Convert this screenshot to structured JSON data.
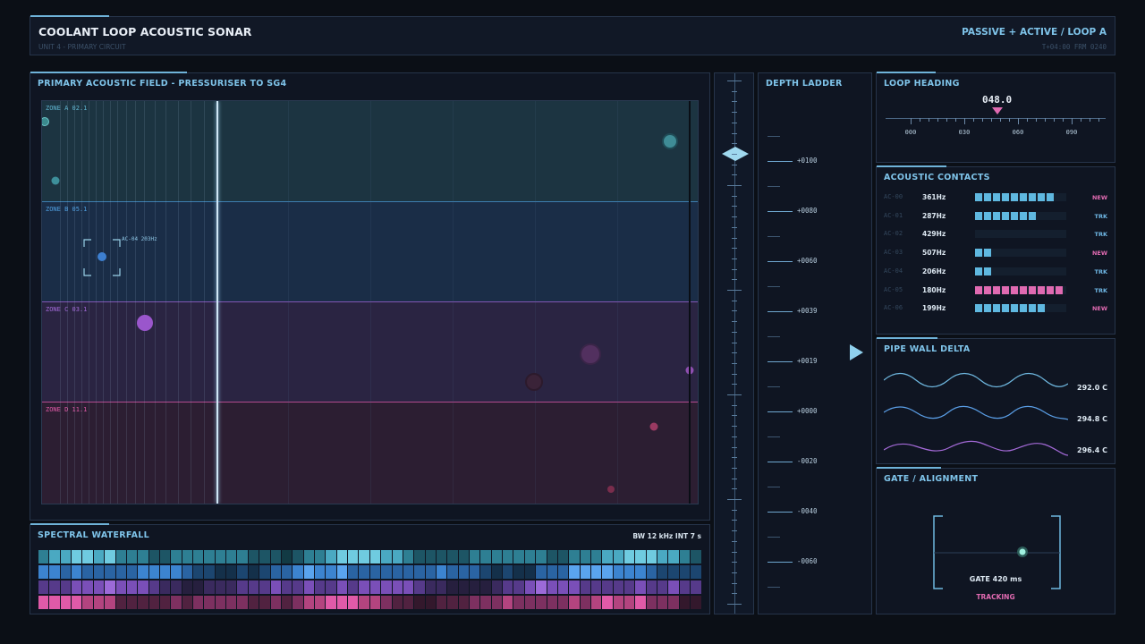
{
  "header": {
    "title": "COOLANT LOOP ACOUSTIC SONAR",
    "subtitle": "UNIT 4 - PRIMARY CIRCUIT",
    "mode": "PASSIVE + ACTIVE / LOOP A",
    "time": "T+04:00  FRM 0240"
  },
  "field": {
    "title": "PRIMARY ACOUSTIC FIELD - PRESSURISER TO SG4",
    "zones": [
      {
        "label": "ZONE A 02.1",
        "color": "#5fb4cf"
      },
      {
        "label": "ZONE B 05.1",
        "color": "#4f9fe0"
      },
      {
        "label": "ZONE C 03.1",
        "color": "#a26ad8"
      },
      {
        "label": "ZONE D 11.1",
        "color": "#e05aa8"
      }
    ],
    "target_label": "AC-04 203Hz"
  },
  "waterfall": {
    "title": "SPECTRAL WATERFALL",
    "info": "BW 12 kHz  INT 7 s"
  },
  "ladder": {
    "title": "DEPTH LADDER",
    "labels": [
      "+0100",
      "+0080",
      "+0060",
      "+0039",
      "+0019",
      "+0000",
      "-0020",
      "-0040",
      "-0060"
    ]
  },
  "heading": {
    "title": "LOOP HEADING",
    "value": "048.0",
    "labels": [
      "000",
      "030",
      "060",
      "090"
    ]
  },
  "contacts": {
    "title": "ACOUSTIC CONTACTS",
    "rows": [
      {
        "id": "AC-00",
        "freq": "361Hz",
        "level": 9,
        "color": "#5fb8e0",
        "status": "NEW",
        "status_color": "#e06ab1"
      },
      {
        "id": "AC-01",
        "freq": "287Hz",
        "level": 7,
        "color": "#5fb8e0",
        "status": "TRK",
        "status_color": "#6fb8e6"
      },
      {
        "id": "AC-02",
        "freq": "429Hz",
        "level": 0,
        "color": "#5fb8e0",
        "status": "TRK",
        "status_color": "#6fb8e6"
      },
      {
        "id": "AC-03",
        "freq": "507Hz",
        "level": 2,
        "color": "#5fb8e0",
        "status": "NEW",
        "status_color": "#e06ab1"
      },
      {
        "id": "AC-04",
        "freq": "206Hz",
        "level": 2,
        "color": "#5fb8e0",
        "status": "TRK",
        "status_color": "#6fb8e6"
      },
      {
        "id": "AC-05",
        "freq": "180Hz",
        "level": 10,
        "color": "#e06ab1",
        "status": "TRK",
        "status_color": "#6fb8e6"
      },
      {
        "id": "AC-06",
        "freq": "199Hz",
        "level": 8,
        "color": "#5fb8e0",
        "status": "NEW",
        "status_color": "#e06ab1"
      }
    ]
  },
  "pipe": {
    "title": "PIPE WALL DELTA",
    "values": [
      "292.0 C",
      "294.8 C",
      "296.4 C"
    ]
  },
  "gate": {
    "title": "GATE / ALIGNMENT",
    "value": "GATE 420 ms",
    "status": "TRACKING"
  }
}
